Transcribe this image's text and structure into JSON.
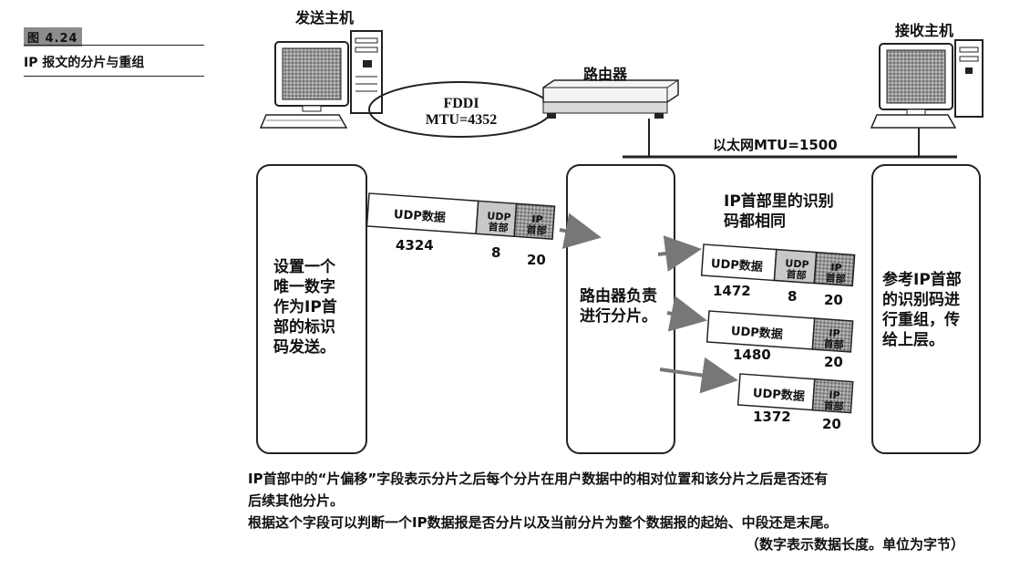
{
  "figure": {
    "number": "图 4.24",
    "title": "IP 报文的分片与重组"
  },
  "hosts": {
    "sender": "发送主机",
    "receiver": "接收主机"
  },
  "router": {
    "label": "路由器"
  },
  "links": {
    "fddi_name": "FDDI",
    "fddi_mtu": "MTU=4352",
    "ethernet": "以太网MTU=1500"
  },
  "boxes": {
    "sender_lines": [
      "设置一个",
      "唯一数字",
      "作为IP首",
      "部的标识",
      "码发送。"
    ],
    "router_lines": [
      "路由器负责",
      "进行分片。"
    ],
    "receiver_lines": [
      "参考IP首部",
      "的识别码进",
      "行重组，传",
      "给上层。"
    ]
  },
  "note": {
    "lines": [
      "IP首部里的识别",
      "码都相同"
    ]
  },
  "packet": {
    "data_label": "UDP数据",
    "udp_header_lines": [
      "UDP",
      "首部"
    ],
    "ip_header_lines": [
      "IP",
      "首部"
    ],
    "original": {
      "data_len": "4324",
      "udp_len": "8",
      "ip_len": "20"
    },
    "fragments": [
      {
        "data_len": "1472",
        "udp_len": "8",
        "ip_len": "20"
      },
      {
        "data_len": "1480",
        "ip_len": "20"
      },
      {
        "data_len": "1372",
        "ip_len": "20"
      }
    ]
  },
  "footer": {
    "lines": [
      "IP首部中的“片偏移”字段表示分片之后每个分片在用户数据中的相对位置和该分片之后是否还有",
      "后续其他分片。",
      "根据这个字段可以判断一个IP数据报是否分片以及当前分片为整个数据报的起始、中段还是末尾。"
    ],
    "unit_note": "（数字表示数据长度。单位为字节）"
  }
}
